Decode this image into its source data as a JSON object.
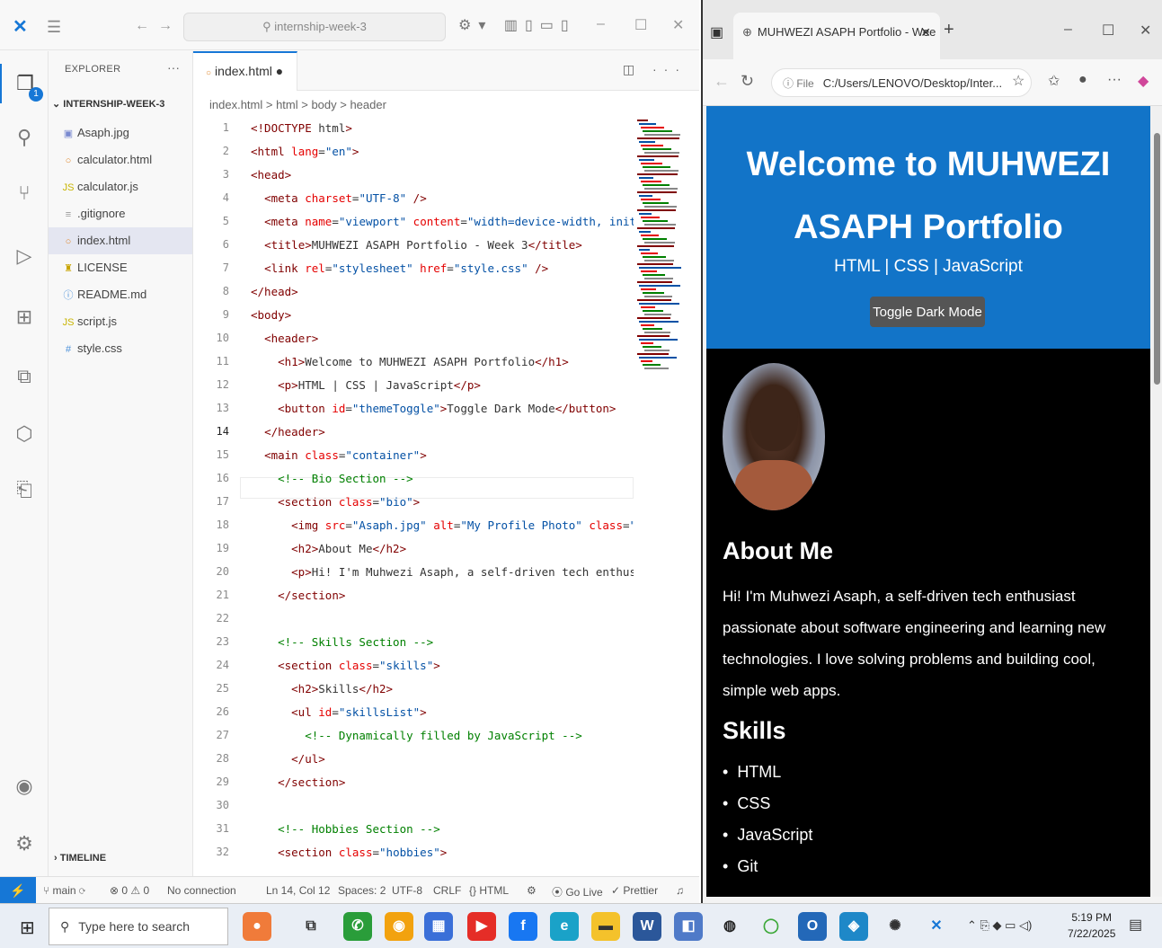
{
  "vscode": {
    "search_text": "internship-week-3",
    "explorer_label": "EXPLORER",
    "project": "INTERNSHIP-WEEK-3",
    "files": [
      {
        "icon": "image",
        "name": "Asaph.jpg"
      },
      {
        "icon": "html",
        "name": "calculator.html"
      },
      {
        "icon": "js",
        "name": "calculator.js"
      },
      {
        "icon": "git",
        "name": ".gitignore"
      },
      {
        "icon": "html",
        "name": "index.html"
      },
      {
        "icon": "license",
        "name": "LICENSE"
      },
      {
        "icon": "info",
        "name": "README.md"
      },
      {
        "icon": "js",
        "name": "script.js"
      },
      {
        "icon": "css",
        "name": "style.css"
      }
    ],
    "timeline_label": "TIMELINE",
    "active_tab": "index.html",
    "breadcrumb": "index.html > html > body > header",
    "source_control_badge": "1",
    "line_numbers": [
      "1",
      "2",
      "3",
      "4",
      "5",
      "6",
      "7",
      "8",
      "9",
      "10",
      "11",
      "12",
      "13",
      "14",
      "15",
      "16",
      "17",
      "18",
      "19",
      "20",
      "21",
      "22",
      "23",
      "24",
      "25",
      "26",
      "27",
      "28",
      "29",
      "30",
      "31",
      "32"
    ],
    "code_lines": [
      "<!DOCTYPE html>",
      "<html lang=\"en\">",
      "<head>",
      "  <meta charset=\"UTF-8\" />",
      "  <meta name=\"viewport\" content=\"width=device-width, initi",
      "  <title>MUHWEZI ASAPH Portfolio - Week 3</title>",
      "  <link rel=\"stylesheet\" href=\"style.css\" />",
      "</head>",
      "<body>",
      "  <header>",
      "    <h1>Welcome to MUHWEZI ASAPH Portfolio</h1>",
      "    <p>HTML | CSS | JavaScript</p>",
      "    <button id=\"themeToggle\">Toggle Dark Mode</button>",
      "  </header>",
      "  <main class=\"container\">",
      "    <!-- Bio Section -->",
      "    <section class=\"bio\">",
      "      <img src=\"Asaph.jpg\" alt=\"My Profile Photo\" class=\"p",
      "      <h2>About Me</h2>",
      "      <p>Hi! I'm Muhwezi Asaph, a self-driven tech enthusi",
      "    </section>",
      "",
      "    <!-- Skills Section -->",
      "    <section class=\"skills\">",
      "      <h2>Skills</h2>",
      "      <ul id=\"skillsList\">",
      "        <!-- Dynamically filled by JavaScript -->",
      "      </ul>",
      "    </section>",
      "",
      "    <!-- Hobbies Section -->",
      "    <section class=\"hobbies\">"
    ],
    "status": {
      "branch": "main",
      "problems": "0",
      "warnings": "0",
      "connection": "No connection",
      "position": "Ln 14, Col 12",
      "spaces": "Spaces: 2",
      "encoding": "UTF-8",
      "eol": "CRLF",
      "language": "HTML",
      "golive": "Go Live",
      "prettier": "Prettier"
    }
  },
  "browser": {
    "tab_title": "MUHWEZI ASAPH Portfolio - Wee",
    "url_prefix": "File",
    "url": "C:/Users/LENOVO/Desktop/Inter..."
  },
  "page": {
    "title": "Welcome to MUHWEZI ASAPH Portfolio",
    "subtitle": "HTML | CSS | JavaScript",
    "toggle_label": "Toggle Dark Mode",
    "about_heading": "About Me",
    "about_text": "Hi! I'm Muhwezi Asaph, a self-driven tech enthusiast passionate about software engineering and learning new technologies. I love solving problems and building cool, simple web apps.",
    "skills_heading": "Skills",
    "skills": [
      "HTML",
      "CSS",
      "JavaScript",
      "Git"
    ],
    "header_color": "#1274c8",
    "body_color": "#000000"
  },
  "taskbar": {
    "search_placeholder": "Type here to search",
    "time": "5:19 PM",
    "date": "7/22/2025"
  }
}
